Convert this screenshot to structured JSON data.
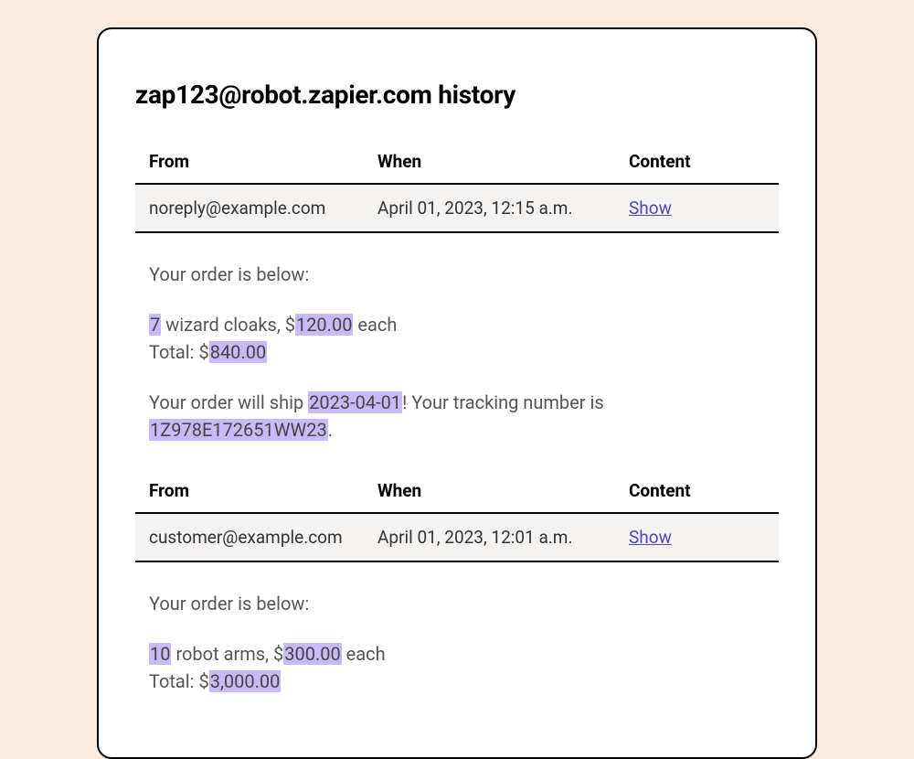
{
  "page_title": "zap123@robot.zapier.com history",
  "headers": {
    "from": "From",
    "when": "When",
    "content": "Content"
  },
  "show_label": "Show",
  "entries": [
    {
      "from": "noreply@example.com",
      "when": "April 01, 2023, 12:15 a.m.",
      "body": {
        "intro": "Your order is below:",
        "qty": "7",
        "item_text_1": " wizard cloaks, $",
        "price": "120.00",
        "item_text_2": " each",
        "total_prefix": "Total: $",
        "total": "840.00",
        "ship_prefix": "Your order will ship ",
        "ship_date": "2023-04-01",
        "ship_mid": "! Your tracking number is ",
        "tracking": "1Z978E172651WW23",
        "ship_suffix": "."
      }
    },
    {
      "from": "customer@example.com",
      "when": "April 01, 2023, 12:01 a.m.",
      "body": {
        "intro": "Your order is below:",
        "qty": "10",
        "item_text_1": " robot arms, $",
        "price": "300.00",
        "item_text_2": " each",
        "total_prefix": "Total: $",
        "total": "3,000.00"
      }
    }
  ]
}
